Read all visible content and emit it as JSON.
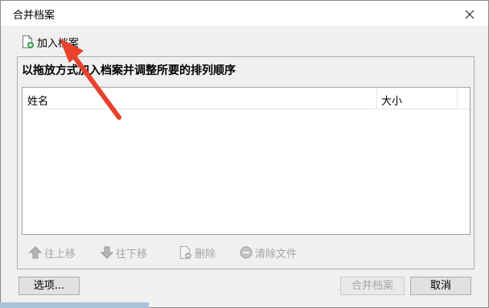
{
  "window": {
    "title": "合并档案"
  },
  "toolbar": {
    "add_label": "加入档案",
    "add_icon": "document-add-icon"
  },
  "instruction": "以拖放方式加入档案并调整所要的排列顺序",
  "list": {
    "columns": [
      "姓名",
      "大小"
    ],
    "rows": []
  },
  "actions": {
    "move_up": "往上移",
    "move_down": "往下移",
    "delete": "删除",
    "clear": "清除文件"
  },
  "buttons": {
    "options": "选项...",
    "merge": "合并档案",
    "cancel": "取消"
  },
  "colors": {
    "annotation_arrow": "#e8412c",
    "add_badge": "#3aa34a"
  }
}
